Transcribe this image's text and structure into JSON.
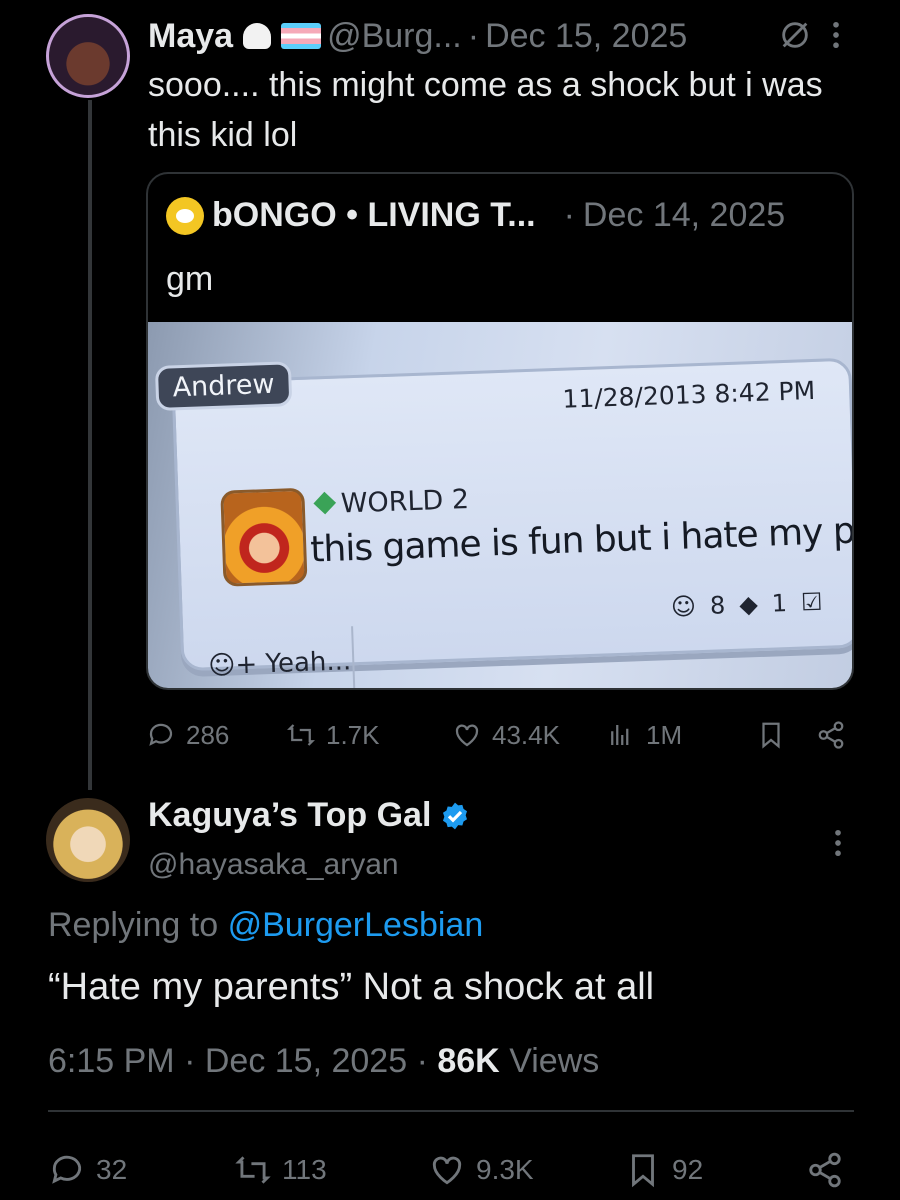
{
  "thread": {
    "post": {
      "display_name": "Maya",
      "handle": "@Burg...",
      "separator": "·",
      "date": "Dec 15, 2025",
      "text": "sooo.... this might come as a shock but i was this kid lol",
      "icons": [
        "ghost-emoji",
        "trans-flag-emoji",
        "hidden-reply-icon",
        "more-icon"
      ],
      "quote": {
        "display_name": "bONGO • LIVING T...",
        "separator": "·",
        "date": "Dec 14, 2025",
        "text": "gm",
        "photo": {
          "user_tag": "Andrew",
          "timestamp": "11/28/2013 8:42 PM",
          "game_label": "WORLD 2",
          "message": "this game is fun but i hate my parents",
          "yeah_label": "Yeah...",
          "yeah_count": "8",
          "comment_count": "1"
        }
      },
      "actions": {
        "replies": "286",
        "reposts": "1.7K",
        "likes": "43.4K",
        "views": "1M"
      }
    },
    "reply": {
      "display_name": "Kaguya’s Top Gal",
      "handle": "@hayasaka_aryan",
      "verified": true,
      "replying_prefix": "Replying to",
      "replying_handle": "@BurgerLesbian",
      "text": "“Hate my parents” Not a shock at all",
      "time": "6:15 PM",
      "date": "Dec 15, 2025",
      "separator": "·",
      "views_count": "86K",
      "views_label": "Views",
      "actions": {
        "replies": "32",
        "reposts": "113",
        "likes": "9.3K",
        "bookmarks": "92"
      }
    }
  },
  "colors": {
    "background": "#000000",
    "text": "#e7e9ea",
    "muted": "#71767b",
    "link": "#1d9bf0",
    "border": "#2f3336",
    "verified": "#1d9bf0"
  }
}
